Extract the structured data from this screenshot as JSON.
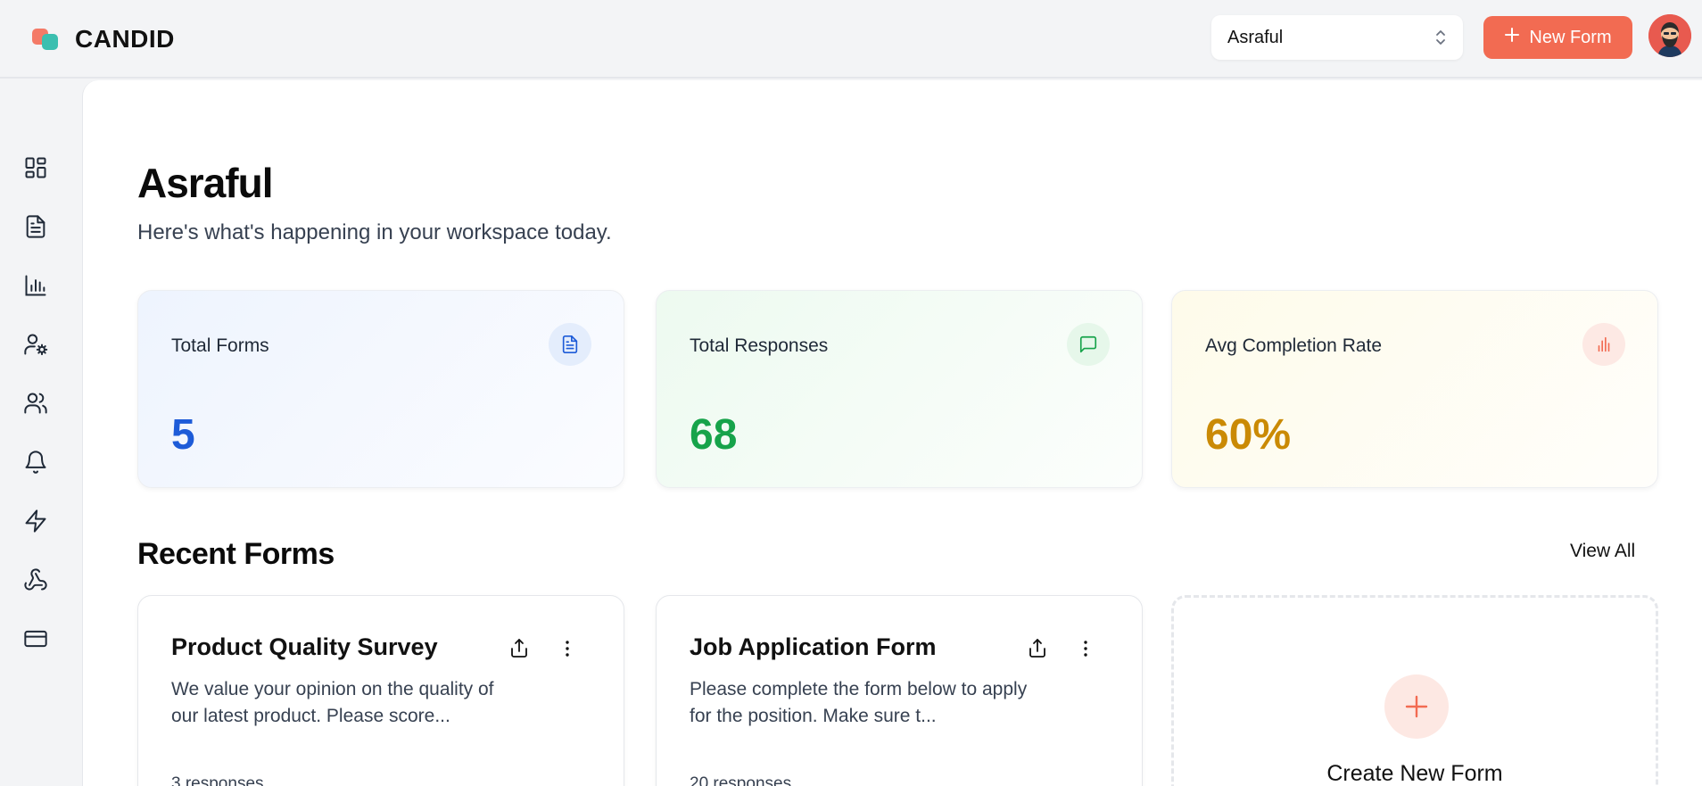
{
  "app": {
    "name": "CANDID"
  },
  "header": {
    "workspace": "Asraful",
    "new_form_label": "New Form"
  },
  "sidebar": {
    "items": [
      {
        "name": "dashboard",
        "icon": "layout-grid-icon"
      },
      {
        "name": "forms",
        "icon": "file-text-icon"
      },
      {
        "name": "analytics",
        "icon": "bar-chart-icon"
      },
      {
        "name": "user-settings",
        "icon": "user-cog-icon"
      },
      {
        "name": "team",
        "icon": "users-icon"
      },
      {
        "name": "notifications",
        "icon": "bell-icon"
      },
      {
        "name": "integrations",
        "icon": "zap-icon"
      },
      {
        "name": "webhooks",
        "icon": "webhook-icon"
      },
      {
        "name": "billing",
        "icon": "credit-card-icon"
      }
    ]
  },
  "main": {
    "title": "Asraful",
    "subtitle": "Here's what's happening in your workspace today.",
    "stats": [
      {
        "label": "Total Forms",
        "value": "5",
        "color": "#1d5bd8",
        "icon": "file-text-icon"
      },
      {
        "label": "Total Responses",
        "value": "68",
        "color": "#16a34a",
        "icon": "message-square-icon"
      },
      {
        "label": "Avg Completion Rate",
        "value": "60%",
        "color": "#ca8a04",
        "icon": "bar-chart-icon"
      }
    ],
    "recent": {
      "title": "Recent Forms",
      "view_all": "View All",
      "forms": [
        {
          "title": "Product Quality Survey",
          "description": "We value your opinion on the quality of our latest product. Please score...",
          "responses": "3 responses"
        },
        {
          "title": "Job Application Form",
          "description": "Please complete the form below to apply for the position. Make sure t...",
          "responses": "20 responses"
        }
      ],
      "create_label": "Create New Form"
    }
  },
  "colors": {
    "accent": "#f26b52",
    "blue": "#1d5bd8",
    "green": "#16a34a",
    "amber": "#ca8a04"
  }
}
